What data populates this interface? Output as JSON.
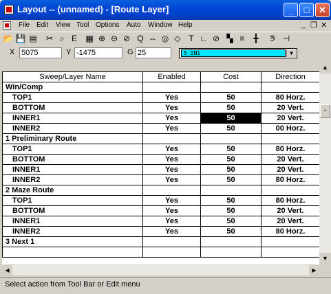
{
  "window": {
    "title": "Layout -- (unnamed) - [Route Layer]",
    "minimize_glyph": "_",
    "maximize_glyph": "□",
    "close_glyph": "✕"
  },
  "menu": {
    "items": [
      "File",
      "Edit",
      "View",
      "Tool",
      "Options",
      "Auto",
      "Window",
      "Help"
    ],
    "mdi_min": "_",
    "mdi_restore": "❐",
    "mdi_close": "✕"
  },
  "toolbar": {
    "buttons": [
      {
        "name": "open-folder-icon",
        "glyph": "📂"
      },
      {
        "name": "save-icon",
        "glyph": "💾"
      },
      {
        "name": "print-icon",
        "glyph": "▤"
      },
      {
        "name": "cut-icon",
        "glyph": "✂"
      },
      {
        "name": "binoculars-icon",
        "glyph": "⌕"
      },
      {
        "name": "text-e-icon",
        "glyph": "E"
      },
      {
        "name": "grid-icon",
        "glyph": "▦"
      },
      {
        "name": "zoom-in-icon",
        "glyph": "⊕"
      },
      {
        "name": "zoom-out-icon",
        "glyph": "⊖"
      },
      {
        "name": "zoom-fit-icon",
        "glyph": "⊘"
      },
      {
        "name": "query-icon",
        "glyph": "Q"
      },
      {
        "name": "move-icon",
        "glyph": "⇔"
      },
      {
        "name": "circle-icon",
        "glyph": "◎"
      },
      {
        "name": "edit-shape-icon",
        "glyph": "◇"
      },
      {
        "name": "text-tool-icon",
        "glyph": "T"
      },
      {
        "name": "dimension-icon",
        "glyph": "∟"
      },
      {
        "name": "no-entry-icon",
        "glyph": "⊘"
      },
      {
        "name": "color-palette-icon",
        "glyph": "▚"
      },
      {
        "name": "drc-icon",
        "glyph": "≡"
      },
      {
        "name": "route-icon",
        "glyph": "╋"
      },
      {
        "name": "tool-a-icon",
        "glyph": "⋾"
      },
      {
        "name": "tool-b-icon",
        "glyph": "⊣"
      }
    ]
  },
  "coords": {
    "x_label": "X",
    "x_value": "5075",
    "y_label": "Y",
    "y_value": "-1475",
    "g_label": "G",
    "g_value": "25",
    "layer_value": "5 IN1",
    "layer_color": "#00e5ff"
  },
  "grid": {
    "headers": [
      "Sweep/Layer Name",
      "Enabled",
      "Cost",
      "Direction"
    ],
    "groups": [
      {
        "name": "Win/Comp",
        "rows": [
          {
            "name": "TOP1",
            "enabled": "Yes",
            "cost": "50",
            "direction": "80 Horz."
          },
          {
            "name": "BOTTOM",
            "enabled": "Yes",
            "cost": "50",
            "direction": "20 Vert."
          },
          {
            "name": "INNER1",
            "enabled": "Yes",
            "cost": "50",
            "direction": "20 Vert.",
            "selected": true
          },
          {
            "name": "INNER2",
            "enabled": "Yes",
            "cost": "50",
            "direction": "00 Horz."
          }
        ]
      },
      {
        "name": "1 Preliminary Route",
        "rows": [
          {
            "name": "TOP1",
            "enabled": "Yes",
            "cost": "50",
            "direction": "80 Horz."
          },
          {
            "name": "BOTTOM",
            "enabled": "Yes",
            "cost": "50",
            "direction": "20 Vert."
          },
          {
            "name": "INNER1",
            "enabled": "Yes",
            "cost": "50",
            "direction": "20 Vert."
          },
          {
            "name": "INNER2",
            "enabled": "Yes",
            "cost": "50",
            "direction": "80 Horz."
          }
        ]
      },
      {
        "name": "2 Maze Route",
        "rows": [
          {
            "name": "TOP1",
            "enabled": "Yes",
            "cost": "50",
            "direction": "80 Horz."
          },
          {
            "name": "BOTTOM",
            "enabled": "Yes",
            "cost": "50",
            "direction": "20 Vert."
          },
          {
            "name": "INNER1",
            "enabled": "Yes",
            "cost": "50",
            "direction": "20 Vert."
          },
          {
            "name": "INNER2",
            "enabled": "Yes",
            "cost": "50",
            "direction": "80 Horz."
          }
        ]
      },
      {
        "name": "3 Next 1",
        "rows": []
      }
    ]
  },
  "scroll": {
    "up": "▲",
    "down": "▼",
    "left": "◀",
    "right": "▶",
    "thumb_grip": "≡"
  },
  "status": {
    "text": "Select action from Tool Bar or Edit menu"
  }
}
